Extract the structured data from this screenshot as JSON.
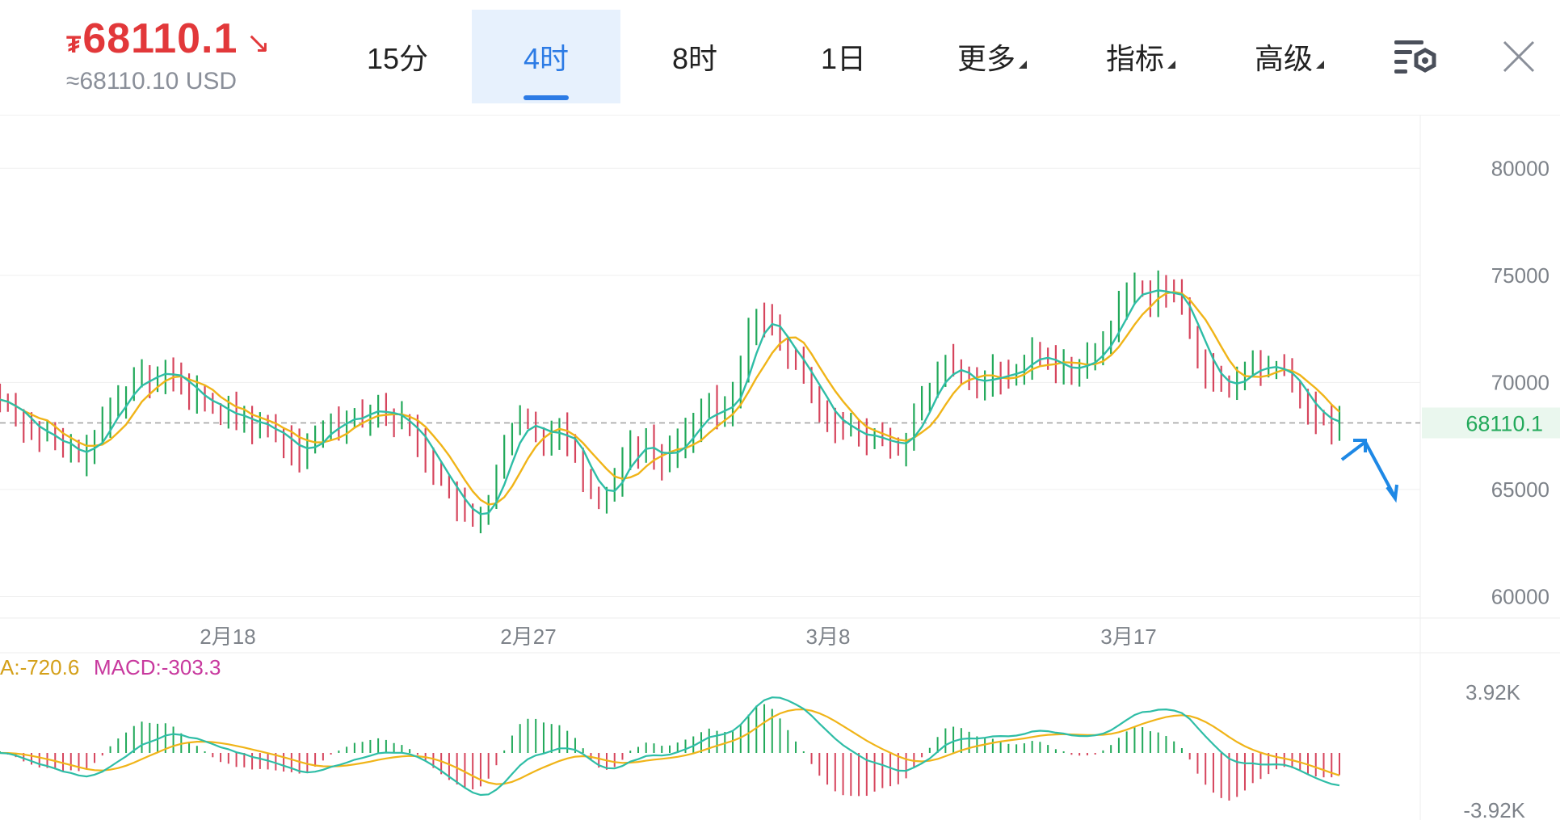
{
  "header": {
    "currency_symbol": "₮",
    "price": "68110.1",
    "trend_arrow": "↘",
    "usd_equiv": "≈68110.10 USD"
  },
  "tabs": [
    {
      "label": "15分",
      "active": false,
      "caret": false
    },
    {
      "label": "4时",
      "active": true,
      "caret": false
    },
    {
      "label": "8时",
      "active": false,
      "caret": false
    },
    {
      "label": "1日",
      "active": false,
      "caret": false
    },
    {
      "label": "更多",
      "active": false,
      "caret": true
    },
    {
      "label": "指标",
      "active": false,
      "caret": true
    },
    {
      "label": "高级",
      "active": false,
      "caret": true
    }
  ],
  "icons": {
    "settings": "chart-settings-icon",
    "close": "close-icon"
  },
  "colors": {
    "up": "#22a95a",
    "down": "#d6455d",
    "ma_fast": "#2ebda6",
    "ma_slow": "#f0b418",
    "accent": "#2c7be5",
    "price_down": "#e2383a"
  },
  "macd_labels": {
    "dea": "A:-720.6",
    "macd": "MACD:-303.3"
  },
  "chart_data": {
    "type": "candlestick",
    "y_ticks": [
      80000,
      75000,
      70000,
      65000,
      60000
    ],
    "ylim": [
      59000,
      82500
    ],
    "x_labels": [
      "2月18",
      "2月27",
      "3月8",
      "3月17"
    ],
    "current_price": "68110.1",
    "close_series": [
      69200,
      69000,
      68500,
      68000,
      67800,
      67500,
      67600,
      67200,
      66800,
      67000,
      66500,
      66700,
      67500,
      68000,
      68800,
      69200,
      69500,
      70200,
      70500,
      70000,
      70300,
      70800,
      70400,
      69800,
      69200,
      69600,
      69000,
      68800,
      68500,
      68700,
      68200,
      68400,
      67900,
      68100,
      67800,
      67500,
      67200,
      67000,
      66600,
      66900,
      67400,
      67800,
      68200,
      68000,
      68300,
      68600,
      68400,
      68700,
      68900,
      68500,
      68200,
      68300,
      67800,
      67200,
      66600,
      66000,
      65400,
      64800,
      64300,
      63800,
      63500,
      63800,
      64500,
      65800,
      66800,
      67800,
      68300,
      68100,
      67700,
      67300,
      67700,
      67900,
      67200,
      66700,
      65700,
      64800,
      64500,
      64900,
      65500,
      66400,
      67200,
      66800,
      67200,
      66600,
      66300,
      66700,
      67300,
      67600,
      68000,
      68600,
      69000,
      68400,
      68700,
      69300,
      70700,
      72200,
      73200,
      73000,
      72500,
      71800,
      71200,
      70800,
      70500,
      69500,
      68800,
      68400,
      68000,
      67800,
      67800,
      67500,
      67200,
      67600,
      67400,
      67000,
      66800,
      67400,
      68500,
      69000,
      69500,
      70500,
      71000,
      70500,
      70300,
      70000,
      69800,
      70200,
      70500,
      70300,
      70200,
      70600,
      71000,
      71500,
      71200,
      70900,
      70600,
      70800,
      70500,
      70800,
      71000,
      71400,
      71800,
      72600,
      73500,
      74100,
      74500,
      74300,
      73900,
      74500,
      74300,
      74000,
      73600,
      72400,
      71100,
      70600,
      70200,
      69800,
      69600,
      70200,
      70600,
      70900,
      70500,
      70700,
      70800,
      70500,
      69800,
      69200,
      68700,
      68400,
      68200,
      68000,
      68110
    ]
  }
}
